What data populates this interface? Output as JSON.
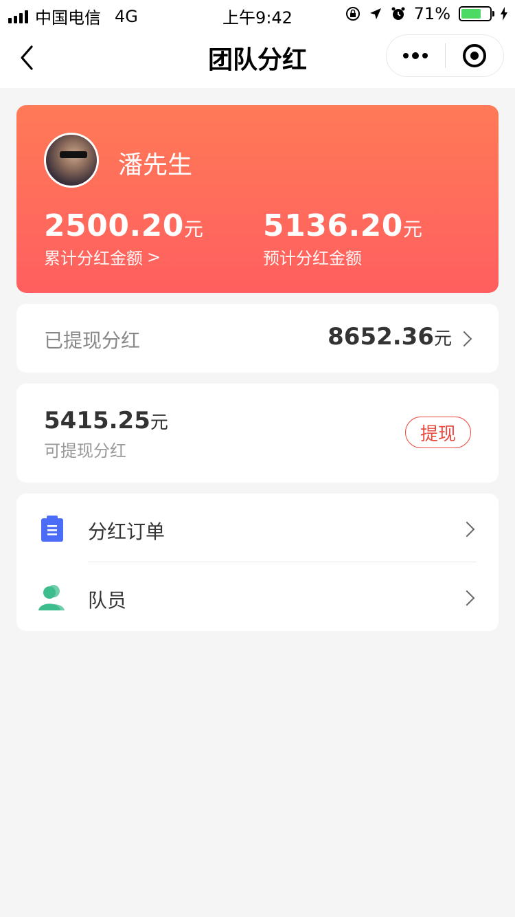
{
  "status_bar": {
    "carrier": "中国电信",
    "network": "4G",
    "time": "上午9:42",
    "battery_percent": "71%",
    "battery_level": 0.71
  },
  "nav": {
    "title": "团队分红",
    "back_icon": "chevron-left-icon",
    "more_icon": "more-dots-icon",
    "close_icon": "target-circle-icon"
  },
  "profile": {
    "name": "潘先生",
    "avatar_icon": "avatar-photo"
  },
  "stats": {
    "total_dividend": {
      "value": "2500.20",
      "unit": "元",
      "label": "累计分红金额",
      "suffix": ">"
    },
    "expected_dividend": {
      "value": "5136.20",
      "unit": "元",
      "label": "预计分红金额"
    }
  },
  "withdrawn": {
    "label": "已提现分红",
    "value": "8652.36",
    "unit": "元"
  },
  "available": {
    "value": "5415.25",
    "unit": "元",
    "label": "可提现分红",
    "button": "提现"
  },
  "menu": {
    "items": [
      {
        "label": "分红订单",
        "icon": "clipboard-icon",
        "color": "#4a6cf7"
      },
      {
        "label": "队员",
        "icon": "team-members-icon",
        "color": "#3dbd8d"
      }
    ]
  },
  "colors": {
    "hero_gradient_top": "#ff7a57",
    "hero_gradient_bottom": "#ff5f5f",
    "accent_red": "#e94a3f",
    "icon_blue": "#4a6cf7",
    "icon_green": "#3dbd8d"
  }
}
